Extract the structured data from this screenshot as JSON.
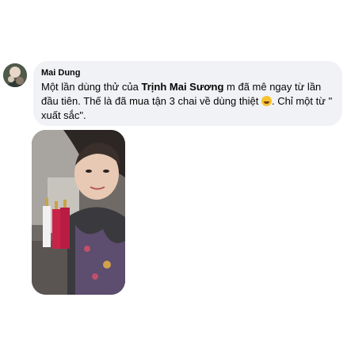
{
  "comment": {
    "author": "Mai Dung",
    "text_before": "Một lần dùng thử của ",
    "mention": "Trịnh Mai Sương",
    "text_after": " m đã mê ngay từ lần đầu tiên. Thế là đã mua tận 3 chai về dùng thiệt ",
    "text_end": ". Chỉ một từ \" xuất sắc\".",
    "emoji": "laughing-crying-emoji-icon"
  },
  "colors": {
    "bubble": "#f0f2f5",
    "text": "#050505",
    "bottle": "#c8244a"
  }
}
